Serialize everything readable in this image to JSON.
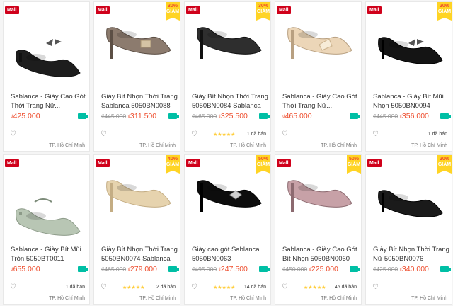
{
  "products": [
    {
      "name": "Sablanca - Giày Cao Gót Thời Trang Nữ...",
      "old": "",
      "price": "425.000",
      "discount": "",
      "mall": "Mall",
      "rating": "",
      "sold": "",
      "location": "TP. Hồ Chí Minh",
      "shoe": "black-kitten-bow"
    },
    {
      "name": "Giày Bít Nhọn Thời Trang Sablanca 5050BN0088",
      "old": "₫445.000",
      "price": "311.500",
      "discount": "30%",
      "mall": "Mall",
      "rating": "",
      "sold": "",
      "location": "TP. Hồ Chí Minh",
      "shoe": "taupe-buckle"
    },
    {
      "name": "Giày Bít Nhọn Thời Trang 5050BN0084 Sablanca",
      "old": "₫465.000",
      "price": "325.500",
      "discount": "30%",
      "mall": "Mall",
      "rating": "★★★★★",
      "sold": "1 đã bán",
      "location": "TP. Hồ Chí Minh",
      "shoe": "black-suede-pump"
    },
    {
      "name": "Sablanca - Giày Cao Gót Thời Trang Nữ...",
      "old": "",
      "price": "465.000",
      "discount": "",
      "mall": "Mall",
      "rating": "",
      "sold": "",
      "location": "TP. Hồ Chí Minh",
      "shoe": "beige-bow"
    },
    {
      "name": "Sablanca - Giày Bít Mũi Nhọn 5050BN0094",
      "old": "₫445.000",
      "price": "356.000",
      "discount": "20%",
      "mall": "Mall",
      "rating": "",
      "sold": "1 đã bán",
      "location": "TP. Hồ Chí Minh",
      "shoe": "black-low-bow"
    },
    {
      "name": "Sablanca - Giày Bít Mũi Tròn 5050BT0011",
      "old": "",
      "price": "655.000",
      "discount": "",
      "mall": "Mall",
      "rating": "",
      "sold": "1 đã bán",
      "location": "TP. Hồ Chí Minh",
      "shoe": "mint-flat"
    },
    {
      "name": "Giày Bít Nhọn Thời Trang 5050BN0074 Sablanca",
      "old": "₫465.000",
      "price": "279.000",
      "discount": "40%",
      "mall": "Mall",
      "rating": "★★★★★",
      "sold": "2 đã bán",
      "location": "TP. Hồ Chí Minh",
      "shoe": "gold-glitter"
    },
    {
      "name": "Giày cao gót Sablanca 5050BN0063",
      "old": "₫495.000",
      "price": "247.500",
      "discount": "50%",
      "mall": "Mall",
      "rating": "★★★★★",
      "sold": "14 đã bán",
      "location": "TP. Hồ Chí Minh",
      "shoe": "patent-black"
    },
    {
      "name": "Sablanca - Giày Cao Gót Bít Nhọn 5050BN0060",
      "old": "₫450.000",
      "price": "225.000",
      "discount": "50%",
      "mall": "Mall",
      "rating": "★★★★★",
      "sold": "45 đã bán",
      "location": "TP. Hồ Chí Minh",
      "shoe": "mauve-pump"
    },
    {
      "name": "Giày Bít Nhọn Thời Trang Nữ 5050BN0076",
      "old": "₫425.000",
      "price": "340.000",
      "discount": "20%",
      "mall": "Mall",
      "rating": "",
      "sold": "",
      "location": "TP. Hồ Chí Minh",
      "shoe": "black-pump"
    }
  ],
  "labels": {
    "giam": "GIẢM",
    "currency": "₫"
  },
  "colors": {
    "accent": "#ee4d2d",
    "mall": "#d0011b",
    "discount_bg": "#ffd424",
    "shipping": "#00bfa5",
    "star": "#ffce3d"
  }
}
